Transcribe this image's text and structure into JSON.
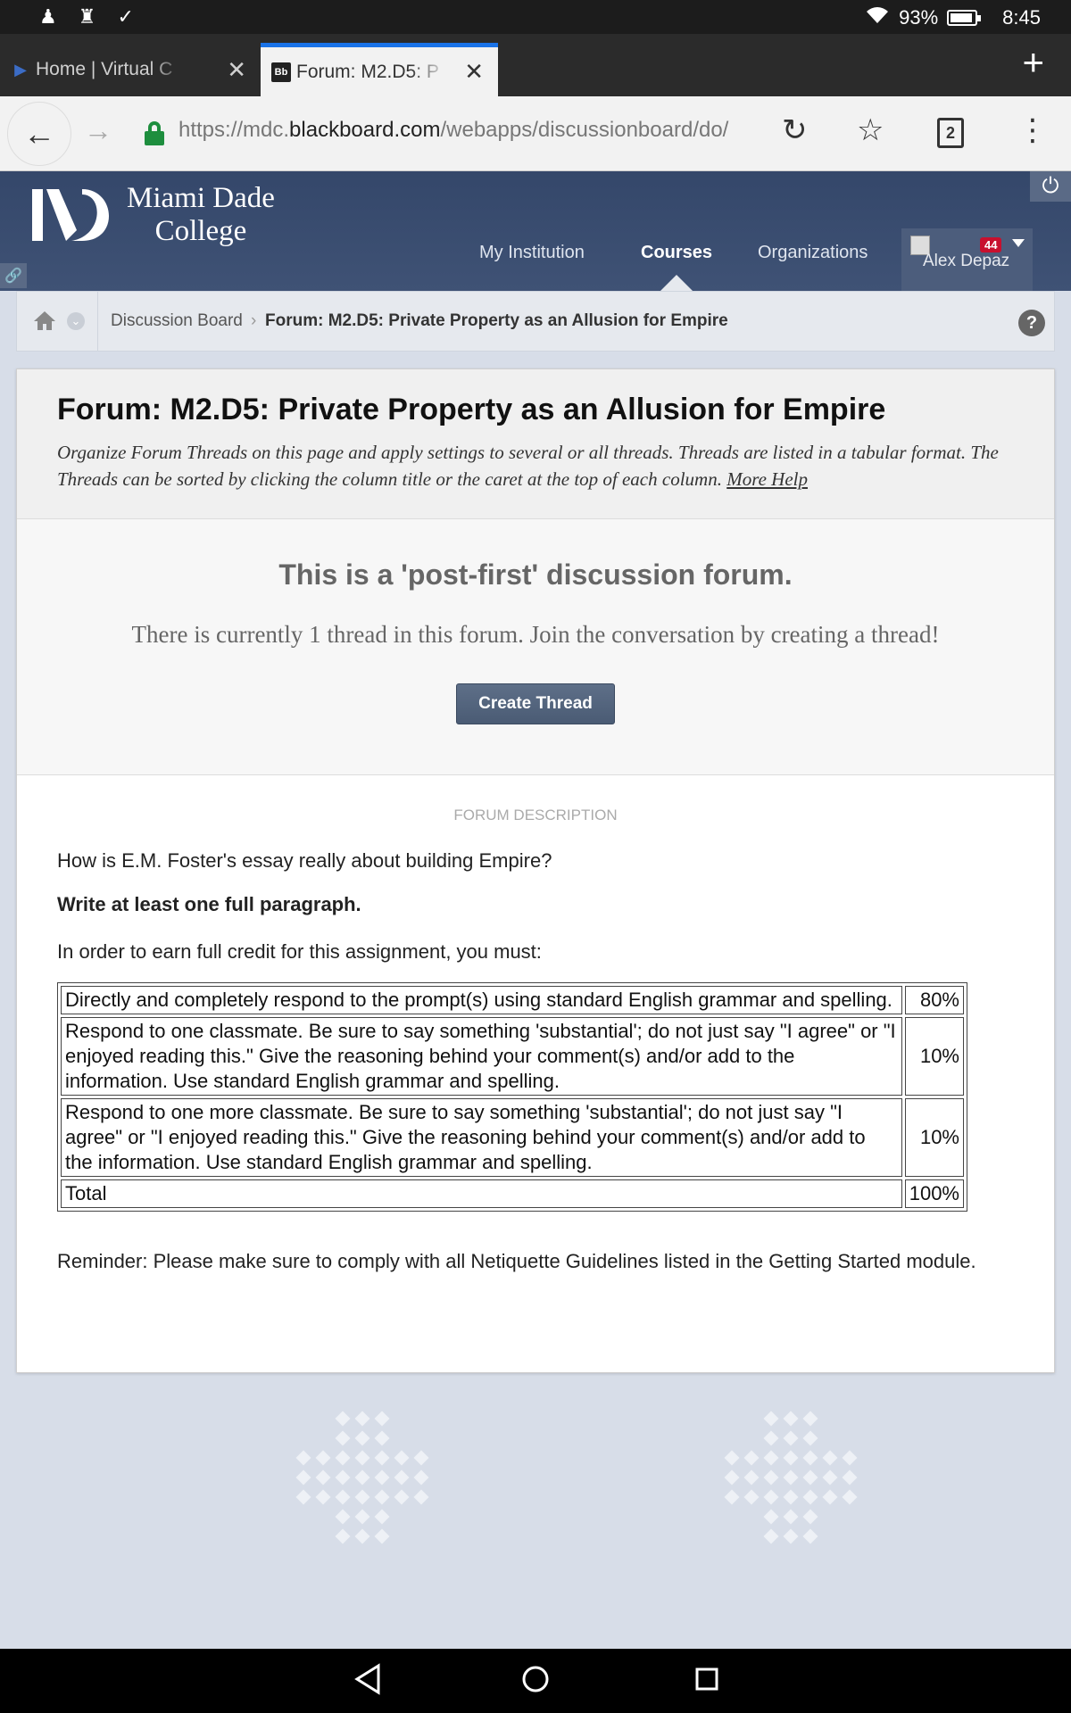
{
  "status_bar": {
    "battery": "93%",
    "time": "8:45",
    "battery_level": 0.93
  },
  "browser": {
    "tabs": [
      {
        "title": "Home | Virtual C",
        "active": false
      },
      {
        "title": "Forum: M2.D5: P",
        "active": true
      }
    ],
    "url_prefix": "https://mdc.",
    "url_domain": "blackboard.com",
    "url_path": "/webapps/discussionboard/do/",
    "tab_count": "2"
  },
  "header": {
    "logo_line1": "Miami Dade",
    "logo_line2": "College",
    "nav": [
      "My Institution",
      "Courses",
      "Organizations"
    ],
    "active_nav": "Courses",
    "user_name": "Alex Depaz",
    "notification_count": "44"
  },
  "breadcrumb": {
    "items": [
      "Discussion Board",
      "Forum: M2.D5: Private Property as an Allusion for Empire"
    ]
  },
  "page": {
    "title": "Forum: M2.D5: Private Property as an Allusion for Empire",
    "instructions": "Organize Forum Threads on this page and apply settings to several or all threads. Threads are listed in a tabular format. The Threads can be sorted by clicking the column title or the caret at the top of each column.",
    "more_help": "More Help"
  },
  "post_first": {
    "title": "This is a 'post-first' discussion forum.",
    "message": "There is currently 1 thread in this forum. Join the conversation by creating a thread!",
    "button": "Create Thread"
  },
  "forum_description": {
    "label": "FORUM DESCRIPTION",
    "question": "How is E.M. Foster's essay really about building Empire?",
    "requirement": "Write at least one full paragraph.",
    "intro": "In order to earn full credit for this assignment, you must:",
    "rubric": [
      {
        "criterion": "Directly and completely respond to the prompt(s) using standard English grammar and spelling.",
        "weight": "80%"
      },
      {
        "criterion": "Respond to one classmate. Be sure to say something 'substantial'; do not just say \"I agree\" or \"I enjoyed reading this.\" Give the reasoning behind your comment(s) and/or add to the information. Use standard English grammar and spelling.",
        "weight": "10%"
      },
      {
        "criterion": "Respond to one more classmate. Be sure to say something 'substantial'; do not just say \"I agree\" or \"I enjoyed reading this.\" Give the reasoning behind your comment(s) and/or add to the information. Use standard English grammar and spelling.",
        "weight": "10%"
      },
      {
        "criterion": "Total",
        "weight": "100%"
      }
    ],
    "reminder": "Reminder: Please make sure to comply with all Netiquette Guidelines listed in the Getting Started module."
  }
}
